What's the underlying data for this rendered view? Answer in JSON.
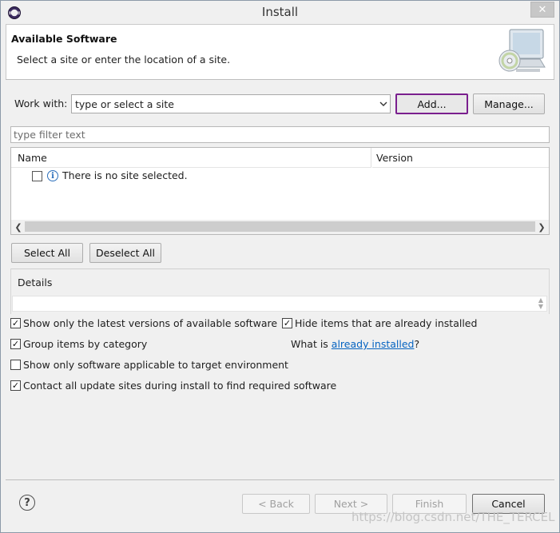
{
  "window": {
    "title": "Install",
    "close_glyph": "✕"
  },
  "header": {
    "title": "Available Software",
    "subtitle": "Select a site or enter the location of a site."
  },
  "work_with": {
    "label": "Work with:",
    "value": "type or select a site",
    "add_label": "Add...",
    "manage_label": "Manage..."
  },
  "filter": {
    "placeholder": "type filter text"
  },
  "tree": {
    "columns": [
      "Name",
      "Version"
    ],
    "rows": [
      {
        "label": "There is no site selected.",
        "checked": false,
        "icon": "info-icon"
      }
    ]
  },
  "selection": {
    "select_all": "Select All",
    "deselect_all": "Deselect All"
  },
  "details": {
    "label": "Details"
  },
  "options": {
    "latest_versions": {
      "label": "Show only the latest versions of available software",
      "checked": true
    },
    "hide_installed": {
      "label": "Hide items that are already installed",
      "checked": true
    },
    "group_by_category": {
      "label": "Group items by category",
      "checked": true
    },
    "what_is_prefix": "What is ",
    "already_installed_link": "already installed",
    "what_is_suffix": "?",
    "target_env": {
      "label": "Show only software applicable to target environment",
      "checked": false
    },
    "contact_sites": {
      "label": "Contact all update sites during install to find required software",
      "checked": true
    }
  },
  "footer": {
    "help_glyph": "?",
    "back_label": "< Back",
    "next_label": "Next >",
    "finish_label": "Finish",
    "cancel_label": "Cancel"
  },
  "watermark": "https://blog.csdn.net/THE_TERCEL",
  "colors": {
    "add_button_border": "#7a1f8e",
    "link": "#0563c1",
    "info_icon": "#2a6ebb"
  }
}
